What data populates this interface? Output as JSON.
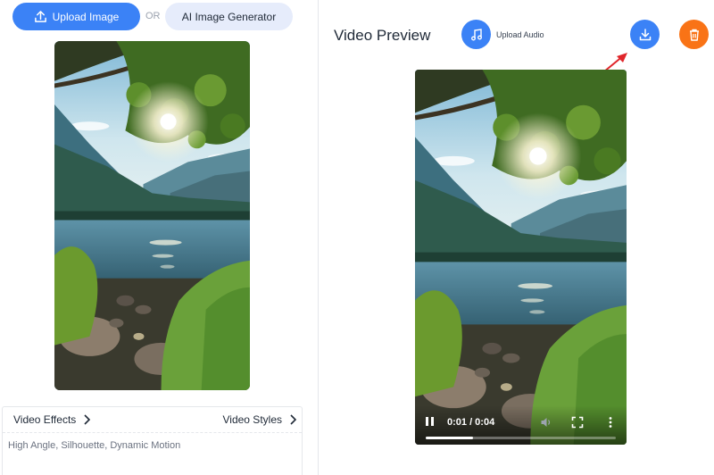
{
  "left_panel": {
    "upload_button": {
      "label": "Upload Image",
      "icon": "upload-icon"
    },
    "or_label": "OR",
    "ai_generator_button": {
      "label": "AI Image Generator"
    },
    "source_image": {
      "description_icon": "image-thumbnail"
    },
    "effects": {
      "video_effects_label": "Video Effects",
      "video_styles_label": "Video Styles",
      "prompt_text": "High Angle, Silhouette, Dynamic Motion"
    }
  },
  "right_panel": {
    "title": "Video Preview",
    "upload_audio_button": {
      "label": "Upload Audio",
      "icon": "music-note-icon"
    },
    "download_button": {
      "icon": "download-icon"
    },
    "delete_button": {
      "icon": "trash-icon"
    },
    "video": {
      "time_display": "0:01 / 0:04",
      "progress": 0.25
    }
  },
  "colors": {
    "primary": "#3b82f6",
    "secondary_button_bg": "#e6ecfb",
    "delete": "#f97316",
    "annotation_arrow": "#e0262b"
  }
}
